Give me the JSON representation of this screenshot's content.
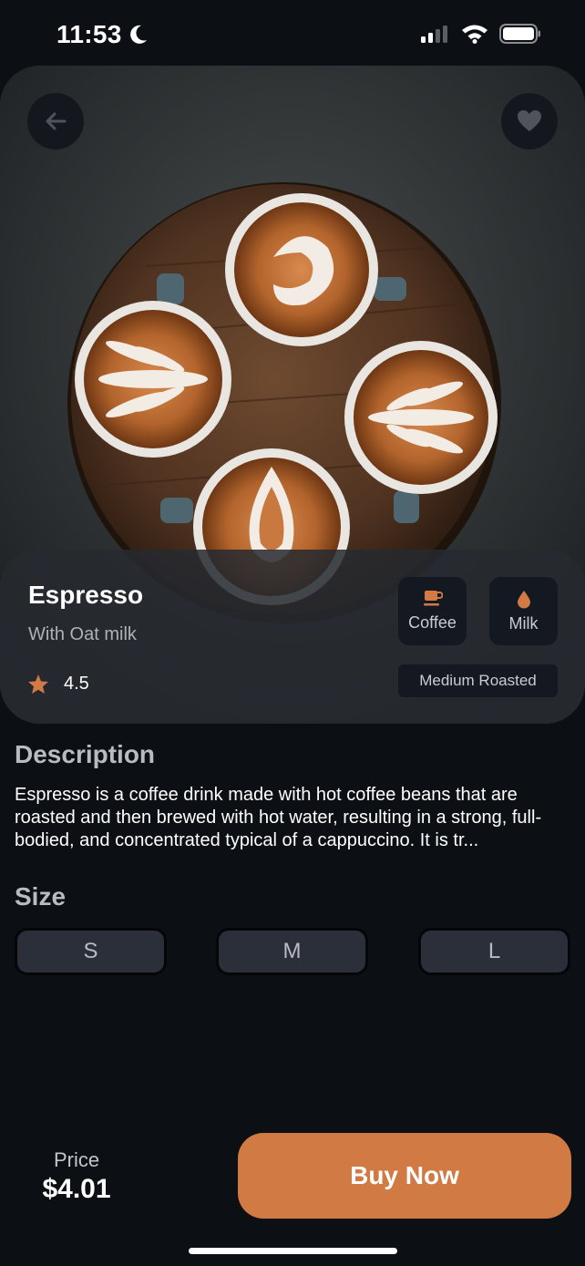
{
  "status_bar": {
    "time": "11:53",
    "icons": [
      "moon-icon",
      "cellular-signal-icon",
      "wifi-icon",
      "battery-icon"
    ]
  },
  "hero": {
    "image": "photo of four cappuccinos with latte art on a round wooden table",
    "icons": {
      "back": "arrow-left-icon",
      "favorite": "heart-icon"
    }
  },
  "product": {
    "name": "Espresso",
    "subtitle": "With Oat milk",
    "rating": "4.5",
    "rating_icon": "star-icon",
    "tags": [
      {
        "label": "Coffee",
        "icon": "coffee-cup-icon"
      },
      {
        "label": "Milk",
        "icon": "drop-icon"
      }
    ],
    "roast": "Medium Roasted"
  },
  "description": {
    "heading": "Description",
    "text": "Espresso is a coffee drink made with hot coffee beans that are roasted and then brewed with hot water, resulting in a strong, full-bodied, and concentrated typical of a cappuccino. It is tr..."
  },
  "size": {
    "heading": "Size",
    "options": [
      "S",
      "M",
      "L"
    ]
  },
  "footer": {
    "price_label": "Price",
    "price_value": "$4.01",
    "buy_label": "Buy Now"
  },
  "colors": {
    "background": "#0c0f14",
    "accent": "#d17a43",
    "panel": "#262a30",
    "chip": "#141820",
    "size_button": "#2a2f3a",
    "muted_text": "#b8bbc0"
  }
}
